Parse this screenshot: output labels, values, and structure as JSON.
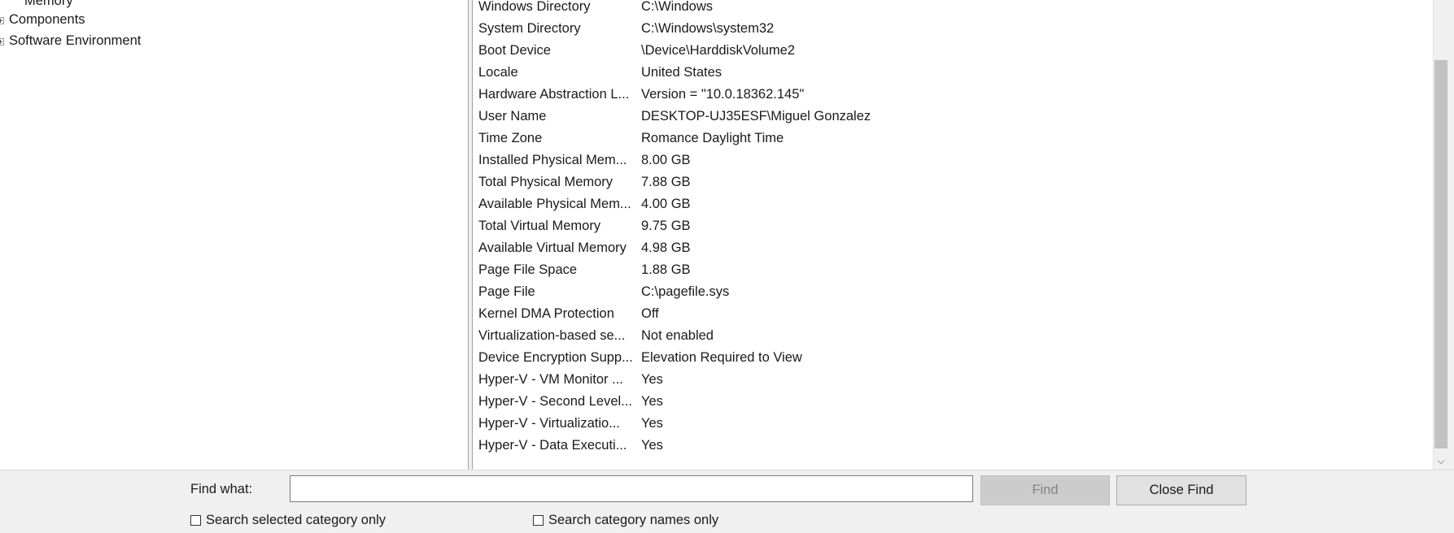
{
  "tree": {
    "items": [
      {
        "label": "Memory",
        "expandable": false
      },
      {
        "label": "Components",
        "expandable": true
      },
      {
        "label": "Software Environment",
        "expandable": true
      }
    ]
  },
  "list": {
    "rows": [
      {
        "item": "Windows Directory",
        "value": "C:\\Windows"
      },
      {
        "item": "System Directory",
        "value": "C:\\Windows\\system32"
      },
      {
        "item": "Boot Device",
        "value": "\\Device\\HarddiskVolume2"
      },
      {
        "item": "Locale",
        "value": "United States"
      },
      {
        "item": "Hardware Abstraction L...",
        "value": "Version = \"10.0.18362.145\""
      },
      {
        "item": "User Name",
        "value": "DESKTOP-UJ35ESF\\Miguel Gonzalez"
      },
      {
        "item": "Time Zone",
        "value": "Romance Daylight Time"
      },
      {
        "item": "Installed Physical Mem...",
        "value": "8.00 GB"
      },
      {
        "item": "Total Physical Memory",
        "value": "7.88 GB"
      },
      {
        "item": "Available Physical Mem...",
        "value": "4.00 GB"
      },
      {
        "item": "Total Virtual Memory",
        "value": "9.75 GB"
      },
      {
        "item": "Available Virtual Memory",
        "value": "4.98 GB"
      },
      {
        "item": "Page File Space",
        "value": "1.88 GB"
      },
      {
        "item": "Page File",
        "value": "C:\\pagefile.sys"
      },
      {
        "item": "Kernel DMA Protection",
        "value": "Off"
      },
      {
        "item": "Virtualization-based se...",
        "value": "Not enabled"
      },
      {
        "item": "Device Encryption Supp...",
        "value": "Elevation Required to View"
      },
      {
        "item": "Hyper-V - VM Monitor ...",
        "value": "Yes"
      },
      {
        "item": "Hyper-V - Second Level...",
        "value": "Yes"
      },
      {
        "item": "Hyper-V - Virtualizatio...",
        "value": "Yes"
      },
      {
        "item": "Hyper-V - Data Executi...",
        "value": "Yes"
      }
    ]
  },
  "find": {
    "label": "Find what:",
    "input_value": "",
    "find_button": "Find",
    "close_button": "Close Find",
    "checkbox_selected_category": "Search selected category only",
    "checkbox_category_names": "Search category names only",
    "checkbox_selected_category_checked": false,
    "checkbox_category_names_checked": false
  },
  "scrollbar": {
    "down_icon": "chevron-down-icon"
  }
}
